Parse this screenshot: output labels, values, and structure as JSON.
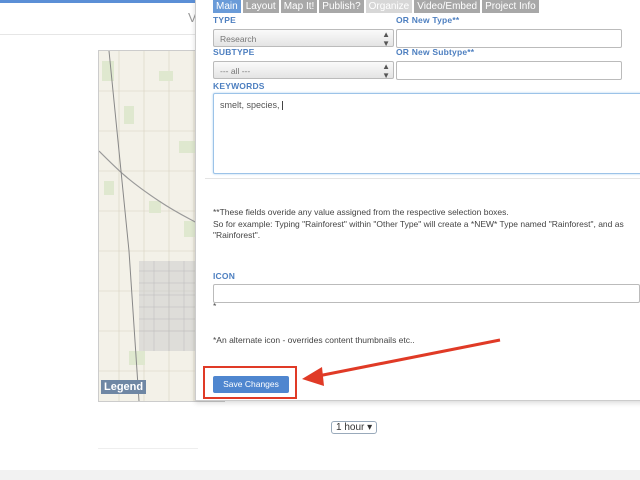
{
  "tabs": [
    "Main",
    "Layout",
    "Map It!",
    "Publish?",
    "Organize",
    "Video/Embed",
    "Project Info"
  ],
  "form": {
    "type_label": "TYPE",
    "new_type_label": "OR New Type**",
    "type_value": "Research",
    "subtype_label": "SUBTYPE",
    "new_subtype_label": "OR New Subtype**",
    "subtype_value": "--- all ---",
    "keywords_label": "KEYWORDS",
    "keywords_value": "smelt, species, ",
    "override_note_1": "**These fields overide any value assigned from the respective selection boxes.",
    "override_note_2": "So for example: Typing \"Rainforest\" within \"Other Type\" will create a *NEW* Type named \"Rainforest\", and as",
    "override_note_3": "\"Rainforest\".",
    "icon_label": "ICON",
    "icon_asterisk": "*",
    "icon_note": "*An alternate icon - overrides content thumbnails etc..",
    "save_label": "Save Changes"
  },
  "map": {
    "legend": "Legend",
    "time_select": "1 hour"
  },
  "colors": {
    "accent": "#4f86cf",
    "label": "#4d7fc0",
    "annotation": "#e03a26"
  }
}
